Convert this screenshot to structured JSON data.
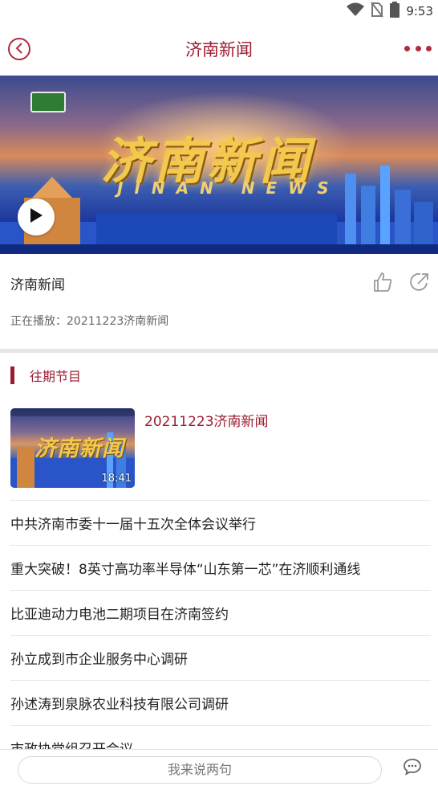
{
  "status_bar": {
    "time": "9:53",
    "icons": [
      "wifi-icon",
      "no-sim-icon",
      "battery-icon"
    ]
  },
  "app_bar": {
    "title": "济南新闻",
    "back_icon": "chevron-left-icon",
    "more_icon": "more-dots-icon"
  },
  "player": {
    "banner_title": "济南新闻",
    "banner_subtitle": "JINAN NEWS",
    "play_icon": "play-icon"
  },
  "info": {
    "name": "济南新闻",
    "now_playing": "正在播放：20211223济南新闻",
    "actions": [
      "thumbs-up-icon",
      "share-icon"
    ]
  },
  "section": {
    "title": "往期节目"
  },
  "episode": {
    "title": "20211223济南新闻",
    "thumb_title": "济南新闻",
    "duration": "18:41"
  },
  "news_items": [
    "中共济南市委十一届十五次全体会议举行",
    "重大突破！8英寸高功率半导体“山东第一芯”在济顺利通线",
    "比亚迪动力电池二期项目在济南签约",
    "孙立成到市企业服务中心调研",
    "孙述涛到泉脉农业科技有限公司调研",
    "市政协党组召开会议"
  ],
  "bottom_bar": {
    "placeholder": "我来说两句",
    "comment_icon": "comment-bubble-icon"
  },
  "colors": {
    "accent": "#9b1d30",
    "divider": "#e6e6e6"
  }
}
